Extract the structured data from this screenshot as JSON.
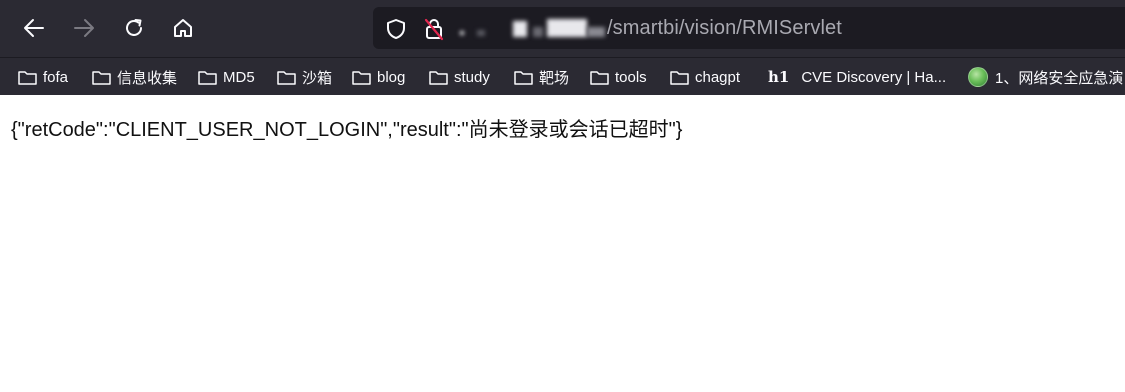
{
  "url": {
    "path": "/smartbi/vision/RMIServlet"
  },
  "bookmarks": [
    {
      "label": "fofa",
      "icon": "folder-icon"
    },
    {
      "label": "信息收集",
      "icon": "folder-icon"
    },
    {
      "label": "MD5",
      "icon": "folder-icon"
    },
    {
      "label": "沙箱",
      "icon": "folder-icon"
    },
    {
      "label": "blog",
      "icon": "folder-icon"
    },
    {
      "label": "study",
      "icon": "folder-icon"
    },
    {
      "label": "靶场",
      "icon": "folder-icon"
    },
    {
      "label": "tools",
      "icon": "folder-icon"
    },
    {
      "label": "chagpt",
      "icon": "folder-icon"
    },
    {
      "label": "CVE Discovery | Ha...",
      "icon": "h1-icon",
      "icon_text": "h1"
    },
    {
      "label": "1、网络安全应急演",
      "icon": "avatar-icon"
    }
  ],
  "page": {
    "body_text": "{\"retCode\":\"CLIENT_USER_NOT_LOGIN\",\"result\":\"尚未登录或会话已超时\"}"
  },
  "colors": {
    "toolbar_bg": "#2b2a33",
    "urlbar_bg": "#1c1b22",
    "toolbar_text": "#fbfbfe",
    "url_text": "#a9a9b1",
    "content_bg": "#ffffff"
  }
}
